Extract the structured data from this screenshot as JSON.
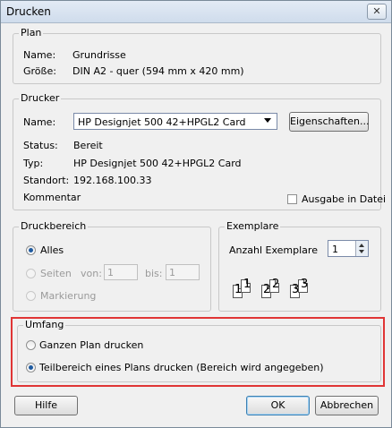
{
  "window": {
    "title": "Drucken",
    "close_label": "✕"
  },
  "plan": {
    "legend": "Plan",
    "name_label": "Name:",
    "name_value": "Grundrisse",
    "size_label": "Größe:",
    "size_value": "DIN A2 - quer (594 mm x 420 mm)"
  },
  "printer": {
    "legend": "Drucker",
    "name_label": "Name:",
    "name_value": "HP Designjet 500 42+HPGL2 Card",
    "properties_button": "Eigenschaften...",
    "status_label": "Status:",
    "status_value": "Bereit",
    "type_label": "Typ:",
    "type_value": "HP Designjet 500 42+HPGL2 Card",
    "location_label": "Standort:",
    "location_value": "192.168.100.33",
    "comment_label": "Kommentar",
    "print_to_file_label": "Ausgabe in Datei",
    "print_to_file_checked": false
  },
  "range": {
    "legend": "Druckbereich",
    "all_label": "Alles",
    "pages_label": "Seiten",
    "from_label": "von:",
    "from_value": "1",
    "to_label": "bis:",
    "to_value": "1",
    "selection_label": "Markierung",
    "selected": "all"
  },
  "copies": {
    "legend": "Exemplare",
    "count_label": "Anzahl Exemplare",
    "count_value": "1",
    "collate_pages": [
      "1",
      "1",
      "2",
      "2",
      "3",
      "3"
    ]
  },
  "scope": {
    "legend": "Umfang",
    "whole_plan_label": "Ganzen Plan drucken",
    "partial_label": "Teilbereich eines Plans drucken (Bereich wird angegeben)",
    "selected": "partial",
    "highlight_color": "#e03535"
  },
  "footer": {
    "help_button": "Hilfe",
    "ok_button": "OK",
    "cancel_button": "Abbrechen"
  }
}
